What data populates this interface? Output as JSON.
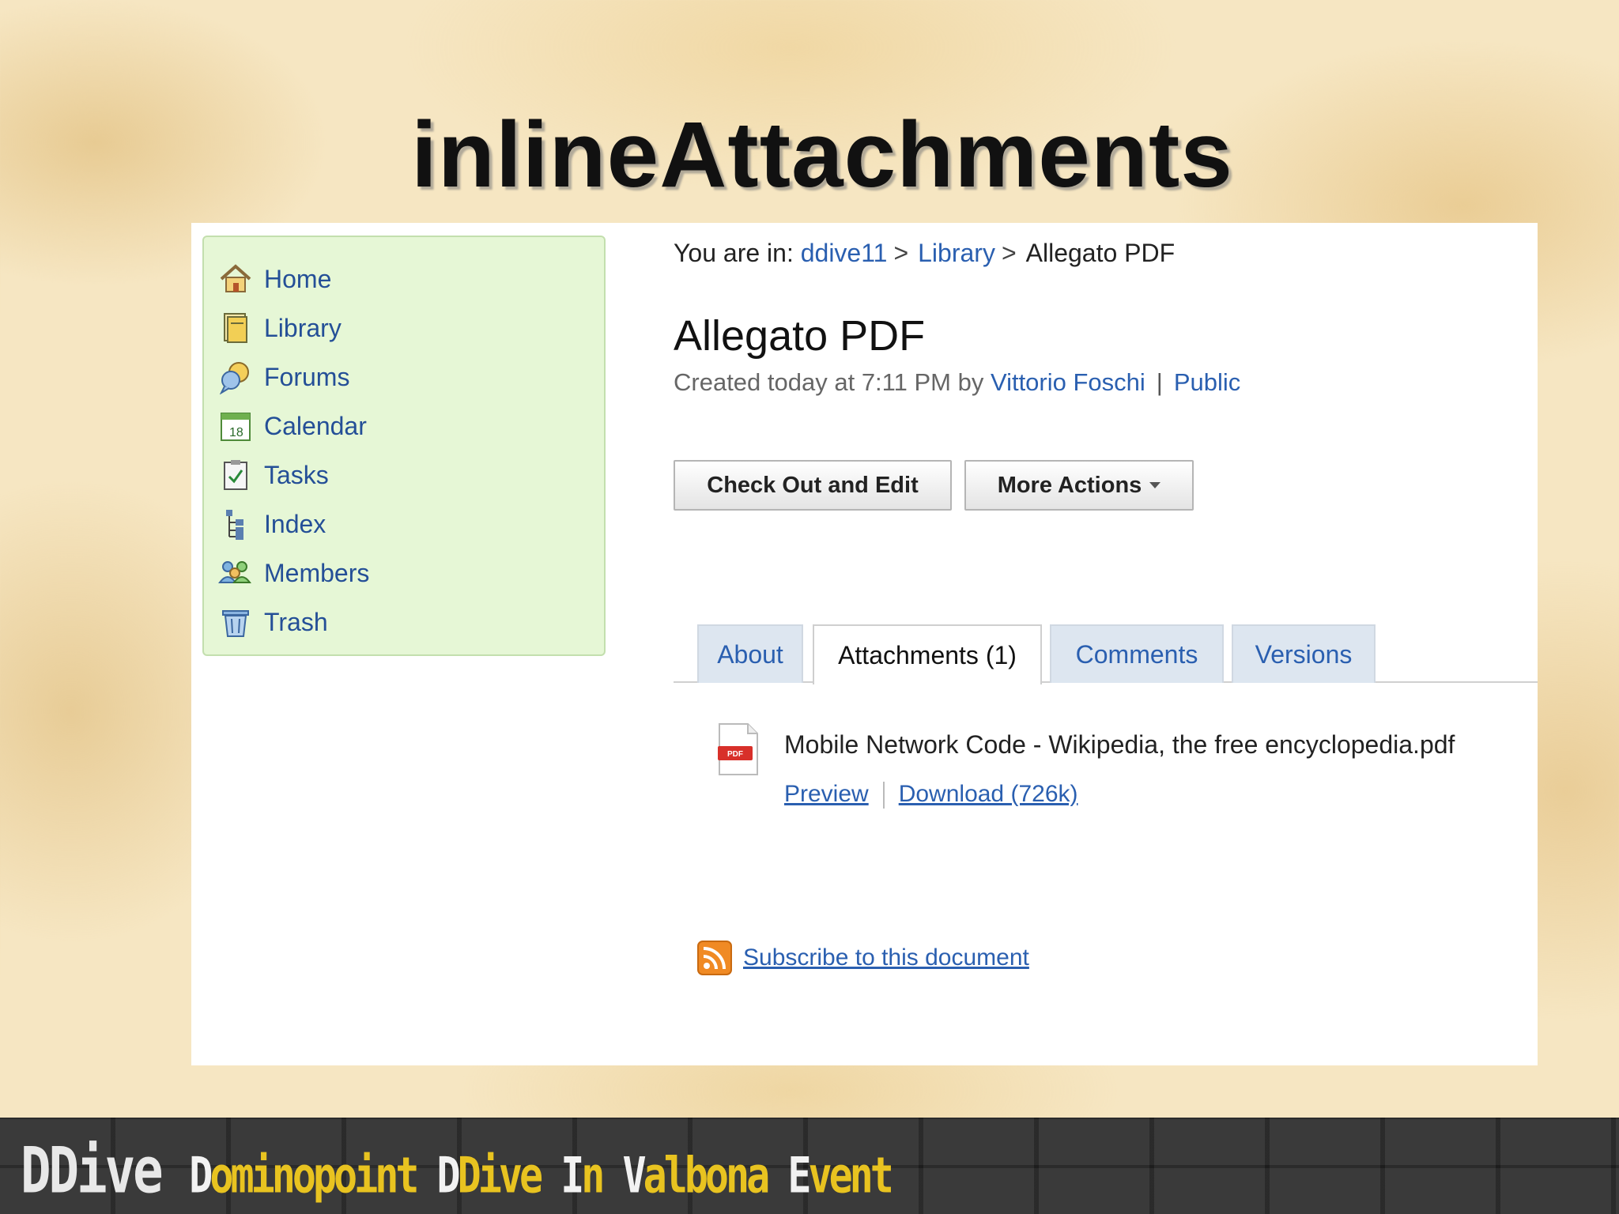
{
  "slide_title": "inlineAttachments",
  "sidebar": {
    "items": [
      {
        "label": "Home",
        "icon": "home-icon"
      },
      {
        "label": "Library",
        "icon": "library-icon"
      },
      {
        "label": "Forums",
        "icon": "forums-icon"
      },
      {
        "label": "Calendar",
        "icon": "calendar-icon"
      },
      {
        "label": "Tasks",
        "icon": "tasks-icon"
      },
      {
        "label": "Index",
        "icon": "index-icon"
      },
      {
        "label": "Members",
        "icon": "members-icon"
      },
      {
        "label": "Trash",
        "icon": "trash-icon"
      }
    ]
  },
  "breadcrumb": {
    "prefix": "You are in:",
    "crumbs": [
      "ddive11",
      "Library"
    ],
    "separator": ">",
    "current": "Allegato PDF"
  },
  "document": {
    "title": "Allegato PDF",
    "created_text": "Created today at 7:11 PM by",
    "author": "Vittorio Foschi",
    "visibility": "Public"
  },
  "actions": {
    "checkout_label": "Check Out and Edit",
    "more_label": "More Actions"
  },
  "tabs": [
    {
      "label": "About",
      "active": false
    },
    {
      "label": "Attachments (1)",
      "active": true
    },
    {
      "label": "Comments",
      "active": false
    },
    {
      "label": "Versions",
      "active": false
    }
  ],
  "attachment": {
    "file_name": "Mobile Network Code - Wikipedia, the free encyclopedia.pdf",
    "badge": "PDF",
    "preview_label": "Preview",
    "download_label": "Download (726k)"
  },
  "subscribe_label": "Subscribe to this document",
  "footer": {
    "brand": "DDive",
    "words": [
      {
        "first": "D",
        "rest": "ominopoint"
      },
      {
        "first": "D",
        "rest": "Dive"
      },
      {
        "first": "I",
        "rest": "n"
      },
      {
        "first": "V",
        "rest": "albona"
      },
      {
        "first": "E",
        "rest": "vent"
      }
    ]
  },
  "colors": {
    "link": "#2a5fb0",
    "sidebar_bg": "#e6f7d6",
    "tab_bg": "#dde6f0",
    "footer_yellow": "#e8c320"
  }
}
